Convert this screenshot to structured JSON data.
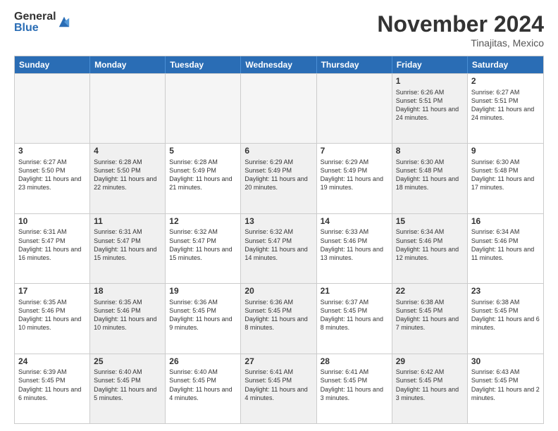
{
  "logo": {
    "general": "General",
    "blue": "Blue"
  },
  "header": {
    "month": "November 2024",
    "location": "Tinajitas, Mexico"
  },
  "weekdays": [
    "Sunday",
    "Monday",
    "Tuesday",
    "Wednesday",
    "Thursday",
    "Friday",
    "Saturday"
  ],
  "rows": [
    [
      {
        "day": "",
        "empty": true
      },
      {
        "day": "",
        "empty": true
      },
      {
        "day": "",
        "empty": true
      },
      {
        "day": "",
        "empty": true
      },
      {
        "day": "",
        "empty": true
      },
      {
        "day": "1",
        "shaded": true,
        "sunrise": "Sunrise: 6:26 AM",
        "sunset": "Sunset: 5:51 PM",
        "daylight": "Daylight: 11 hours and 24 minutes."
      },
      {
        "day": "2",
        "shaded": false,
        "sunrise": "Sunrise: 6:27 AM",
        "sunset": "Sunset: 5:51 PM",
        "daylight": "Daylight: 11 hours and 24 minutes."
      }
    ],
    [
      {
        "day": "3",
        "shaded": false,
        "sunrise": "Sunrise: 6:27 AM",
        "sunset": "Sunset: 5:50 PM",
        "daylight": "Daylight: 11 hours and 23 minutes."
      },
      {
        "day": "4",
        "shaded": true,
        "sunrise": "Sunrise: 6:28 AM",
        "sunset": "Sunset: 5:50 PM",
        "daylight": "Daylight: 11 hours and 22 minutes."
      },
      {
        "day": "5",
        "shaded": false,
        "sunrise": "Sunrise: 6:28 AM",
        "sunset": "Sunset: 5:49 PM",
        "daylight": "Daylight: 11 hours and 21 minutes."
      },
      {
        "day": "6",
        "shaded": true,
        "sunrise": "Sunrise: 6:29 AM",
        "sunset": "Sunset: 5:49 PM",
        "daylight": "Daylight: 11 hours and 20 minutes."
      },
      {
        "day": "7",
        "shaded": false,
        "sunrise": "Sunrise: 6:29 AM",
        "sunset": "Sunset: 5:49 PM",
        "daylight": "Daylight: 11 hours and 19 minutes."
      },
      {
        "day": "8",
        "shaded": true,
        "sunrise": "Sunrise: 6:30 AM",
        "sunset": "Sunset: 5:48 PM",
        "daylight": "Daylight: 11 hours and 18 minutes."
      },
      {
        "day": "9",
        "shaded": false,
        "sunrise": "Sunrise: 6:30 AM",
        "sunset": "Sunset: 5:48 PM",
        "daylight": "Daylight: 11 hours and 17 minutes."
      }
    ],
    [
      {
        "day": "10",
        "shaded": false,
        "sunrise": "Sunrise: 6:31 AM",
        "sunset": "Sunset: 5:47 PM",
        "daylight": "Daylight: 11 hours and 16 minutes."
      },
      {
        "day": "11",
        "shaded": true,
        "sunrise": "Sunrise: 6:31 AM",
        "sunset": "Sunset: 5:47 PM",
        "daylight": "Daylight: 11 hours and 15 minutes."
      },
      {
        "day": "12",
        "shaded": false,
        "sunrise": "Sunrise: 6:32 AM",
        "sunset": "Sunset: 5:47 PM",
        "daylight": "Daylight: 11 hours and 15 minutes."
      },
      {
        "day": "13",
        "shaded": true,
        "sunrise": "Sunrise: 6:32 AM",
        "sunset": "Sunset: 5:47 PM",
        "daylight": "Daylight: 11 hours and 14 minutes."
      },
      {
        "day": "14",
        "shaded": false,
        "sunrise": "Sunrise: 6:33 AM",
        "sunset": "Sunset: 5:46 PM",
        "daylight": "Daylight: 11 hours and 13 minutes."
      },
      {
        "day": "15",
        "shaded": true,
        "sunrise": "Sunrise: 6:34 AM",
        "sunset": "Sunset: 5:46 PM",
        "daylight": "Daylight: 11 hours and 12 minutes."
      },
      {
        "day": "16",
        "shaded": false,
        "sunrise": "Sunrise: 6:34 AM",
        "sunset": "Sunset: 5:46 PM",
        "daylight": "Daylight: 11 hours and 11 minutes."
      }
    ],
    [
      {
        "day": "17",
        "shaded": false,
        "sunrise": "Sunrise: 6:35 AM",
        "sunset": "Sunset: 5:46 PM",
        "daylight": "Daylight: 11 hours and 10 minutes."
      },
      {
        "day": "18",
        "shaded": true,
        "sunrise": "Sunrise: 6:35 AM",
        "sunset": "Sunset: 5:46 PM",
        "daylight": "Daylight: 11 hours and 10 minutes."
      },
      {
        "day": "19",
        "shaded": false,
        "sunrise": "Sunrise: 6:36 AM",
        "sunset": "Sunset: 5:45 PM",
        "daylight": "Daylight: 11 hours and 9 minutes."
      },
      {
        "day": "20",
        "shaded": true,
        "sunrise": "Sunrise: 6:36 AM",
        "sunset": "Sunset: 5:45 PM",
        "daylight": "Daylight: 11 hours and 8 minutes."
      },
      {
        "day": "21",
        "shaded": false,
        "sunrise": "Sunrise: 6:37 AM",
        "sunset": "Sunset: 5:45 PM",
        "daylight": "Daylight: 11 hours and 8 minutes."
      },
      {
        "day": "22",
        "shaded": true,
        "sunrise": "Sunrise: 6:38 AM",
        "sunset": "Sunset: 5:45 PM",
        "daylight": "Daylight: 11 hours and 7 minutes."
      },
      {
        "day": "23",
        "shaded": false,
        "sunrise": "Sunrise: 6:38 AM",
        "sunset": "Sunset: 5:45 PM",
        "daylight": "Daylight: 11 hours and 6 minutes."
      }
    ],
    [
      {
        "day": "24",
        "shaded": false,
        "sunrise": "Sunrise: 6:39 AM",
        "sunset": "Sunset: 5:45 PM",
        "daylight": "Daylight: 11 hours and 6 minutes."
      },
      {
        "day": "25",
        "shaded": true,
        "sunrise": "Sunrise: 6:40 AM",
        "sunset": "Sunset: 5:45 PM",
        "daylight": "Daylight: 11 hours and 5 minutes."
      },
      {
        "day": "26",
        "shaded": false,
        "sunrise": "Sunrise: 6:40 AM",
        "sunset": "Sunset: 5:45 PM",
        "daylight": "Daylight: 11 hours and 4 minutes."
      },
      {
        "day": "27",
        "shaded": true,
        "sunrise": "Sunrise: 6:41 AM",
        "sunset": "Sunset: 5:45 PM",
        "daylight": "Daylight: 11 hours and 4 minutes."
      },
      {
        "day": "28",
        "shaded": false,
        "sunrise": "Sunrise: 6:41 AM",
        "sunset": "Sunset: 5:45 PM",
        "daylight": "Daylight: 11 hours and 3 minutes."
      },
      {
        "day": "29",
        "shaded": true,
        "sunrise": "Sunrise: 6:42 AM",
        "sunset": "Sunset: 5:45 PM",
        "daylight": "Daylight: 11 hours and 3 minutes."
      },
      {
        "day": "30",
        "shaded": false,
        "sunrise": "Sunrise: 6:43 AM",
        "sunset": "Sunset: 5:45 PM",
        "daylight": "Daylight: 11 hours and 2 minutes."
      }
    ]
  ]
}
